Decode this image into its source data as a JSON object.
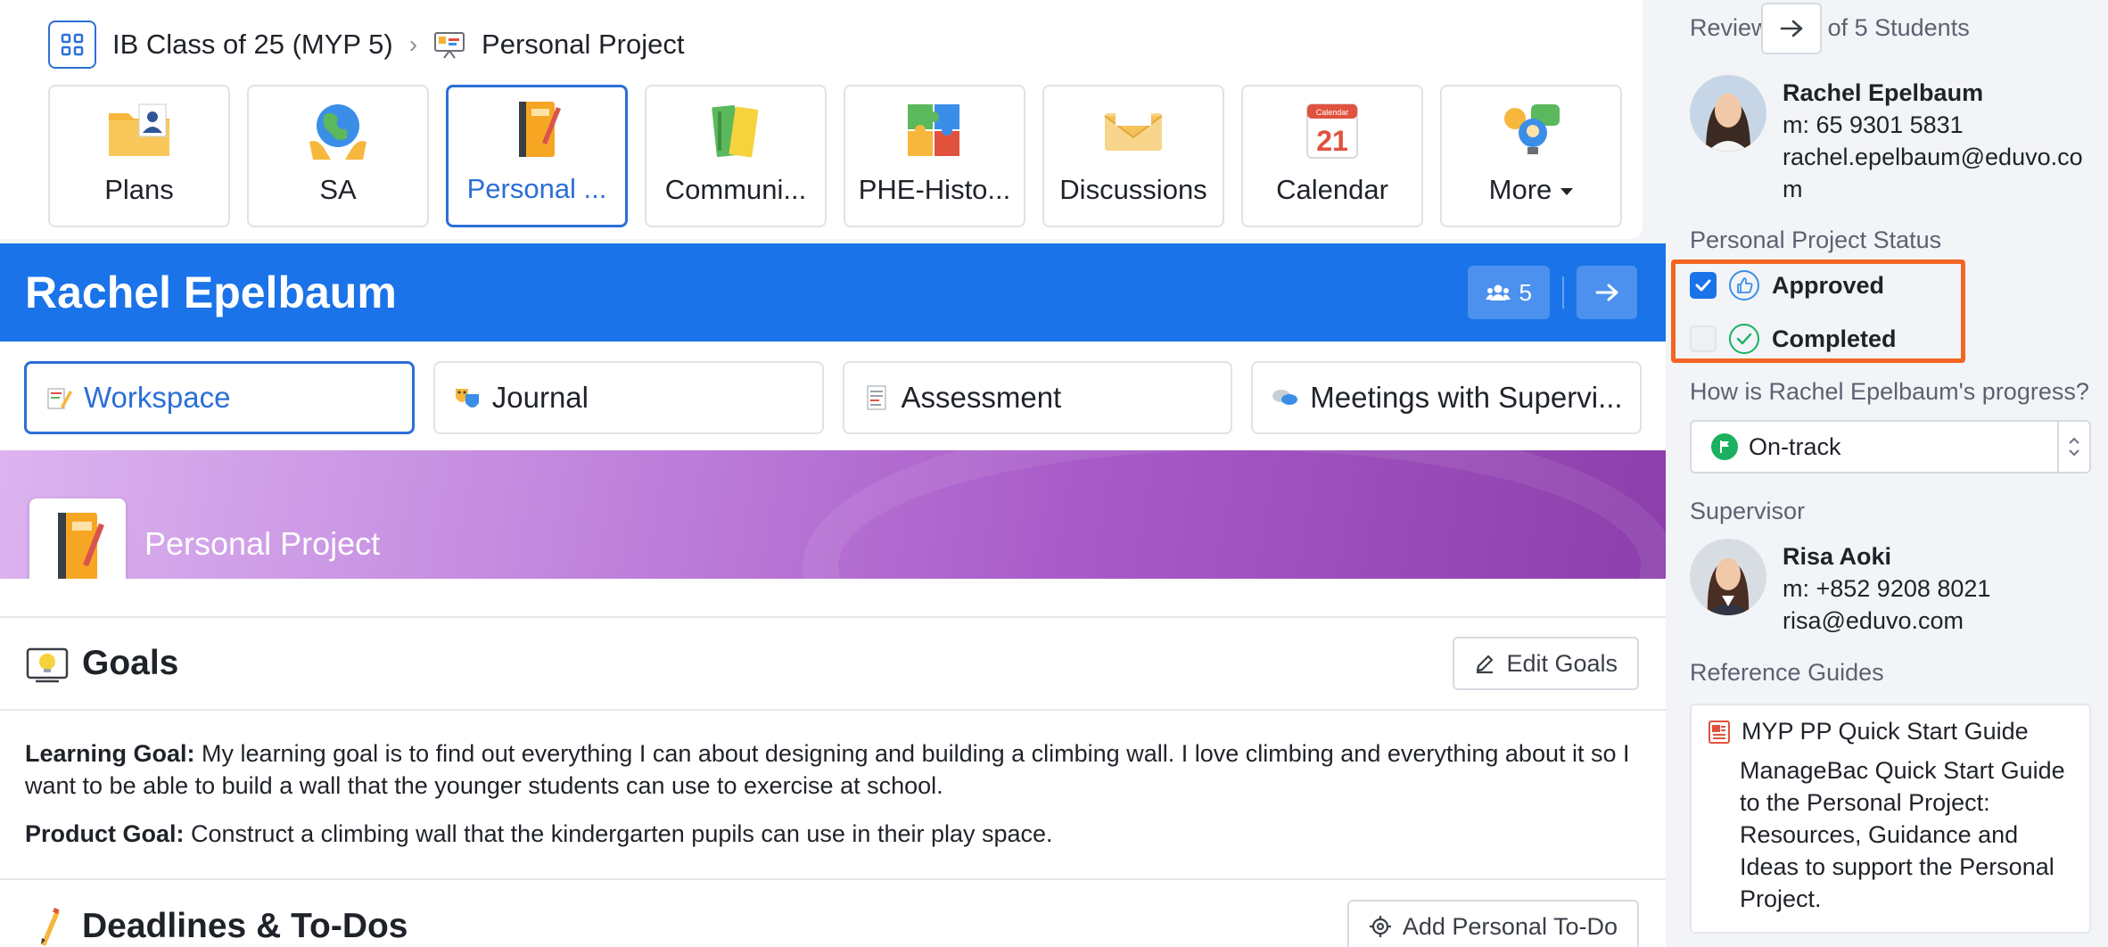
{
  "breadcrumb": {
    "class_name": "IB Class of 25 (MYP 5)",
    "separator": "›",
    "current": "Personal Project"
  },
  "tiles": [
    {
      "label": "Plans",
      "icon": "folder-person-icon"
    },
    {
      "label": "SA",
      "icon": "globe-hands-icon"
    },
    {
      "label": "Personal ...",
      "icon": "notebook-pencil-icon",
      "active": true
    },
    {
      "label": "Communi...",
      "icon": "books-icon"
    },
    {
      "label": "PHE-Histo...",
      "icon": "puzzle-icon"
    },
    {
      "label": "Discussions",
      "icon": "envelope-icon"
    },
    {
      "label": "Calendar",
      "icon": "calendar-icon",
      "calendar_header": "Calendar",
      "calendar_day": "21"
    },
    {
      "label": "More",
      "icon": "chevron-down-icon"
    }
  ],
  "student": {
    "name": "Rachel Epelbaum",
    "count": "5"
  },
  "subtabs": [
    {
      "label": "Workspace",
      "active": true
    },
    {
      "label": "Journal"
    },
    {
      "label": "Assessment"
    },
    {
      "label": "Meetings with Supervi..."
    }
  ],
  "banner": {
    "title": "Personal Project"
  },
  "goals": {
    "title": "Goals",
    "edit_button": "Edit Goals",
    "learning_label": "Learning Goal:",
    "learning_text": "My learning goal is to find out everything I can about designing and building a climbing wall. I love climbing and everything about it so I want to be able to build a wall that the younger students can use to exercise at school.",
    "product_label": "Product Goal:",
    "product_text": "Construct a climbing wall that the kindergarten pupils can use in their play space."
  },
  "deadlines": {
    "title": "Deadlines & To-Dos",
    "add_button": "Add Personal To-Do"
  },
  "sidebar": {
    "reviewing": "Reviewing 1 of 5 Students",
    "student": {
      "name": "Rachel Epelbaum",
      "mobile": "m: 65 9301 5831",
      "email_line1": "rachel.epelbaum@eduvo.co",
      "email_line2": "m"
    },
    "status_label": "Personal Project Status",
    "status": [
      {
        "label": "Approved",
        "checked": true
      },
      {
        "label": "Completed",
        "checked": false
      }
    ],
    "progress_question": "How is Rachel Epelbaum's progress?",
    "progress_value": "On-track",
    "supervisor_label": "Supervisor",
    "supervisor": {
      "name": "Risa Aoki",
      "mobile": "m: +852 9208 8021",
      "email": "risa@eduvo.com"
    },
    "guides_label": "Reference Guides",
    "guide": {
      "title": "MYP PP Quick Start Guide",
      "description": "ManageBac Quick Start Guide to the Personal Project: Resources, Guidance and Ideas to support the Personal Project."
    }
  },
  "colors": {
    "primary": "#1a73e8",
    "highlight": "#f26522",
    "on_track": "#1bb160"
  }
}
